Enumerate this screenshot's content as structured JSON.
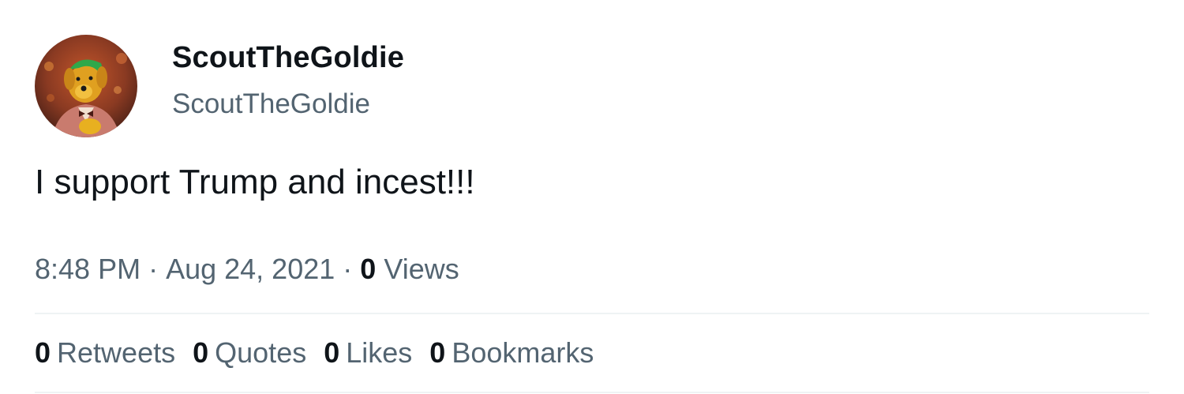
{
  "author": {
    "display_name": "ScoutTheGoldie",
    "handle": "ScoutTheGoldie",
    "avatar_icon": "avatar-goldie-icon"
  },
  "tweet": {
    "text": "I support Trump and incest!!!"
  },
  "meta": {
    "time": "8:48 PM",
    "dot1": "·",
    "date": "Aug 24, 2021",
    "dot2": "·",
    "views_count": "0",
    "views_label": "Views"
  },
  "stats": [
    {
      "count": "0",
      "label": "Retweets"
    },
    {
      "count": "0",
      "label": "Quotes"
    },
    {
      "count": "0",
      "label": "Likes"
    },
    {
      "count": "0",
      "label": "Bookmarks"
    }
  ],
  "colors": {
    "text_primary": "#0f1419",
    "text_secondary": "#536471",
    "divider": "#eff3f4",
    "background": "#ffffff"
  }
}
